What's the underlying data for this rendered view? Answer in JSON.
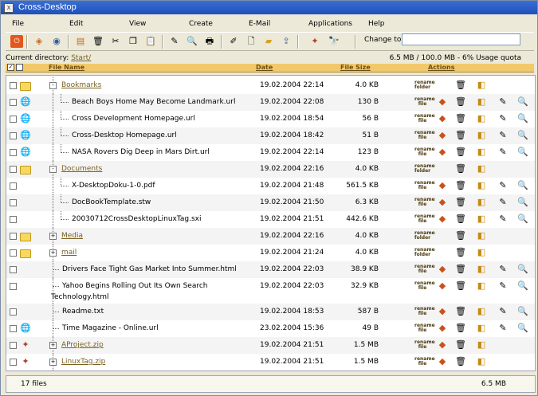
{
  "window": {
    "title": "Cross-Desktop"
  },
  "menu": [
    {
      "label": "File"
    },
    {
      "label": "Edit"
    },
    {
      "label": "View"
    },
    {
      "label": "Create"
    },
    {
      "label": "E-Mail"
    },
    {
      "label": "Applications"
    },
    {
      "label": "Help"
    }
  ],
  "toolbar": {
    "change_to_label": "Change to",
    "change_to_value": "",
    "icons": [
      "power-icon",
      "back-icon",
      "network-icon",
      "properties-icon",
      "delete-icon",
      "cut-icon",
      "copy-icon",
      "paste-icon",
      "edit-icon",
      "preview-icon",
      "print-icon",
      "new-file-icon",
      "new-doc-icon",
      "new-folder-icon",
      "upload-icon",
      "zip-icon",
      "search-icon"
    ]
  },
  "current_directory": {
    "label": "Current directory:",
    "path": "Start/"
  },
  "quota": "6.5 MB / 100.0 MB - 6% Usage quota",
  "columns": {
    "name": "File Name",
    "date": "Date",
    "size": "File Size",
    "actions": "Actions"
  },
  "rename_folder_label": "rename folder",
  "rename_file_label": "rename file",
  "files": [
    {
      "type": "folder",
      "name": "Bookmarks",
      "date": "19.02.2004 22:14",
      "size": "4.0 KB",
      "depth": 0,
      "expander": "-"
    },
    {
      "type": "url",
      "name": "Beach Boys Home May Become Landmark.url",
      "date": "19.02.2004 22:08",
      "size": "130 B",
      "depth": 1
    },
    {
      "type": "url",
      "name": "Cross Development Homepage.url",
      "date": "19.02.2004 18:54",
      "size": "56 B",
      "depth": 1
    },
    {
      "type": "url",
      "name": "Cross-Desktop Homepage.url",
      "date": "19.02.2004 18:42",
      "size": "51 B",
      "depth": 1
    },
    {
      "type": "url",
      "name": "NASA Rovers Dig Deep in Mars Dirt.url",
      "date": "19.02.2004 22:14",
      "size": "123 B",
      "depth": 1
    },
    {
      "type": "folder",
      "name": "Documents",
      "date": "19.02.2004 22:16",
      "size": "4.0 KB",
      "depth": 0,
      "expander": "-"
    },
    {
      "type": "file",
      "name": "X-DesktopDoku-1-0.pdf",
      "date": "19.02.2004 21:48",
      "size": "561.5 KB",
      "depth": 1
    },
    {
      "type": "file",
      "name": "DocBookTemplate.stw",
      "date": "19.02.2004 21:50",
      "size": "6.3 KB",
      "depth": 1
    },
    {
      "type": "file",
      "name": "20030712CrossDesktopLinuxTag.sxi",
      "date": "19.02.2004 21:51",
      "size": "442.6 KB",
      "depth": 1
    },
    {
      "type": "folder",
      "name": "Media",
      "date": "19.02.2004 22:16",
      "size": "4.0 KB",
      "depth": 0,
      "expander": "+"
    },
    {
      "type": "folder",
      "name": "mail",
      "date": "19.02.2004 21:24",
      "size": "4.0 KB",
      "depth": 0,
      "expander": "+"
    },
    {
      "type": "file",
      "name": "Drivers Face Tight Gas Market Into Summer.html",
      "date": "19.02.2004 22:03",
      "size": "38.9 KB",
      "depth": 0
    },
    {
      "type": "file",
      "name": "Yahoo Begins Rolling Out Its Own Search",
      "name2": "Technology.html",
      "date": "19.02.2004 22:03",
      "size": "32.9 KB",
      "depth": 0
    },
    {
      "type": "file",
      "name": "Readme.txt",
      "date": "19.02.2004 18:53",
      "size": "587 B",
      "depth": 0
    },
    {
      "type": "url",
      "name": "Time Magazine - Online.url",
      "date": "23.02.2004 15:36",
      "size": "49 B",
      "depth": 0
    },
    {
      "type": "zip",
      "name": "AProject.zip",
      "date": "19.02.2004 21:51",
      "size": "1.5 MB",
      "depth": 0,
      "expander": "+"
    },
    {
      "type": "zip",
      "name": "LinuxTag.zip",
      "date": "19.02.2004 21:51",
      "size": "1.5 MB",
      "depth": 0,
      "expander": "+"
    }
  ],
  "status": {
    "count": "17 files",
    "total": "6.5 MB"
  }
}
